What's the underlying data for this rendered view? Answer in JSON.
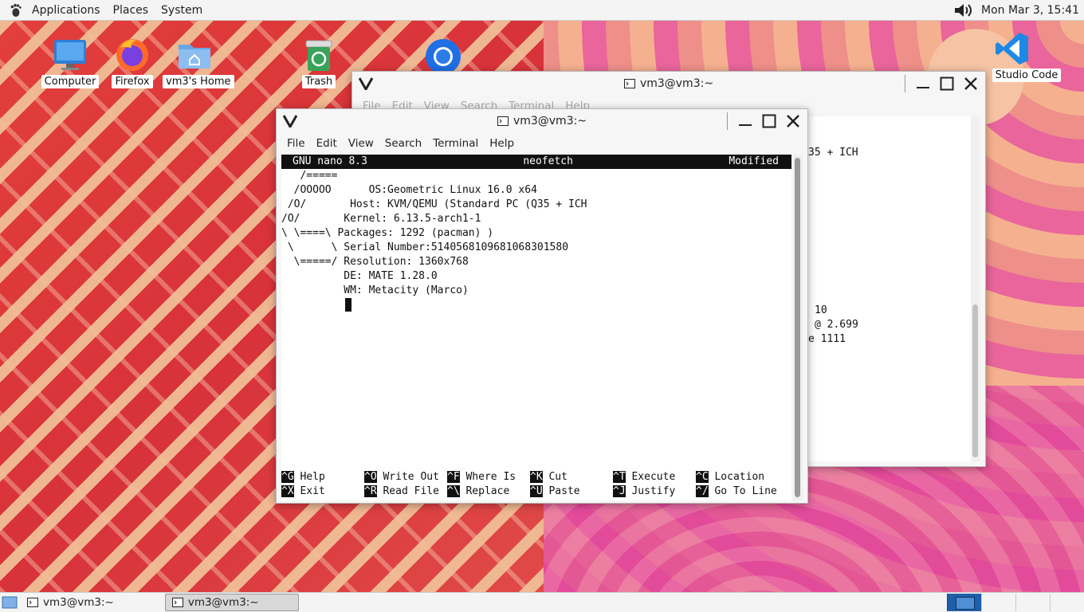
{
  "top_panel": {
    "applications": "Applications",
    "places": "Places",
    "system": "System",
    "clock": "Mon Mar 3, 15:41"
  },
  "desktop_icons": [
    {
      "label": "Computer"
    },
    {
      "label": "Firefox"
    },
    {
      "label": "vm3's Home"
    },
    {
      "label": "Trash"
    },
    {
      "label": "Studio Code"
    }
  ],
  "back_window": {
    "title": "vm3@vm3:~",
    "menu": [
      "File",
      "Edit",
      "View",
      "Search",
      "Terminal",
      "Help"
    ],
    "partial_lines": [
      "35 + ICH",
      "10",
      "@ 2.699",
      "e 1111"
    ]
  },
  "front_window": {
    "title": "vm3@vm3:~",
    "menu": [
      "File",
      "Edit",
      "View",
      "Search",
      "Terminal",
      "Help"
    ],
    "nano_header": {
      "left": "GNU nano 8.3",
      "center": "neofetch",
      "right": "Modified"
    },
    "lines": [
      "   /=====",
      "  /OOOOO      OS:Geometric Linux 16.0 x64",
      " /O/       Host: KVM/QEMU (Standard PC (Q35 + ICH",
      "/O/       Kernel: 6.13.5-arch1-1",
      "\\ \\====\\ Packages: 1292 (pacman) )",
      " \\      \\ Serial Number:5140568109681068301580",
      "  \\=====/ Resolution: 1360x768",
      "          DE: MATE 1.28.0",
      "          WM: Metacity (Marco)"
    ],
    "shortcuts_row1": [
      {
        "key": "^G",
        "label": " Help"
      },
      {
        "key": "^O",
        "label": " Write Out"
      },
      {
        "key": "^F",
        "label": " Where Is"
      },
      {
        "key": "^K",
        "label": " Cut"
      },
      {
        "key": "^T",
        "label": " Execute"
      },
      {
        "key": "^C",
        "label": " Location"
      }
    ],
    "shortcuts_row2": [
      {
        "key": "^X",
        "label": " Exit"
      },
      {
        "key": "^R",
        "label": " Read File"
      },
      {
        "key": "^\\",
        "label": " Replace"
      },
      {
        "key": "^U",
        "label": " Paste"
      },
      {
        "key": "^J",
        "label": " Justify"
      },
      {
        "key": "^/",
        "label": " Go To Line"
      }
    ]
  },
  "taskbar": {
    "items": [
      "vm3@vm3:~",
      "vm3@vm3:~"
    ]
  }
}
